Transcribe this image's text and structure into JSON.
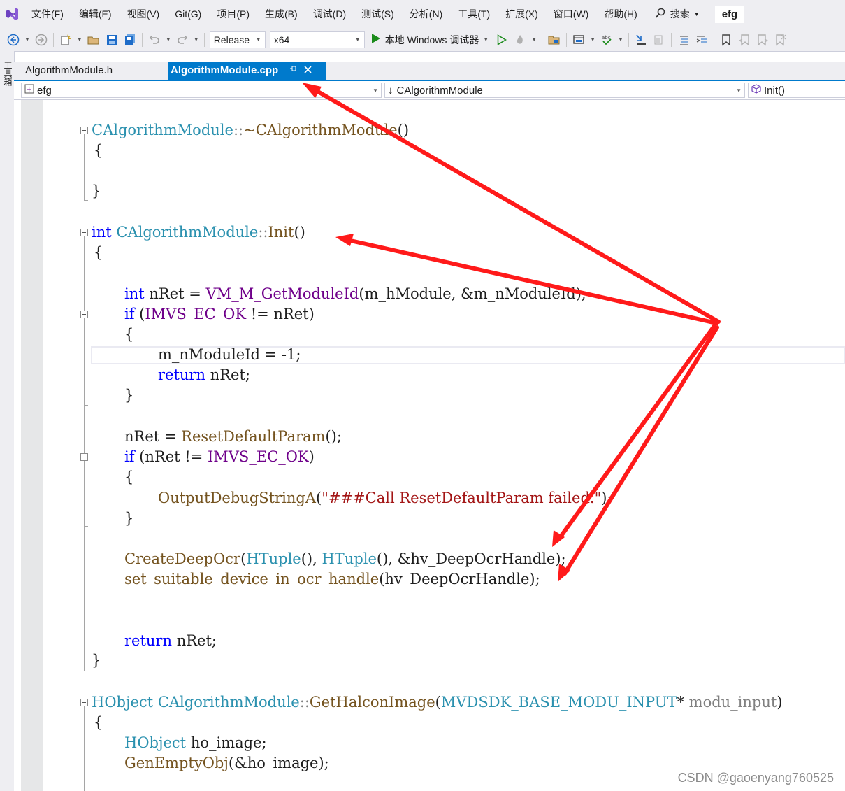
{
  "menu": {
    "items": [
      "文件(F)",
      "编辑(E)",
      "视图(V)",
      "Git(G)",
      "项目(P)",
      "生成(B)",
      "调试(D)",
      "测试(S)",
      "分析(N)",
      "工具(T)",
      "扩展(X)",
      "窗口(W)",
      "帮助(H)"
    ],
    "search_label": "搜索",
    "solution_name": "efg"
  },
  "toolbar": {
    "configuration": "Release",
    "platform": "x64",
    "run_label": "本地 Windows 调试器"
  },
  "toolbox": {
    "label": "工具箱"
  },
  "tabs": [
    {
      "label": "AlgorithmModule.h",
      "active": false
    },
    {
      "label": "AlgorithmModule.cpp",
      "active": true
    }
  ],
  "navbar": {
    "project": "efg",
    "scope": "CAlgorithmModule",
    "member": "Init()"
  },
  "code": {
    "l1_class": "CAlgorithmModule",
    "l1_sep": "::",
    "l1_name": "~CAlgorithmModule",
    "l1_parens": "()",
    "open_brace": "{",
    "close_brace": "}",
    "l2_int": "int",
    "l2_class": "CAlgorithmModule",
    "l2_sep": "::",
    "l2_name": "Init",
    "l2_parens": "()",
    "l3_int": "int",
    "l3_var": "nRet",
    "l3_eq": " = ",
    "l3_macro": "VM_M_GetModuleId",
    "l3_args": "(m_hModule, &m_nModuleId);",
    "l4_if": "if",
    "l4_open": " (",
    "l4_macro": "IMVS_EC_OK",
    "l4_ne": " != ",
    "l4_var": "nRet",
    "l4_close": ")",
    "l5_text": "m_nModuleId = -1;",
    "l6_return": "return",
    "l6_var": "nRet",
    "l6_semi": ";",
    "l7_var": "nRet",
    "l7_eq": " = ",
    "l7_fn": "ResetDefaultParam",
    "l7_rest": "();",
    "l8_if": "if",
    "l8_open": " (",
    "l8_var": "nRet",
    "l8_ne": " != ",
    "l8_macro": "IMVS_EC_OK",
    "l8_close": ")",
    "l9_fn": "OutputDebugStringA",
    "l9_open": "(",
    "l9_str": "\"###Call ResetDefaultParam failed.\"",
    "l9_close": ");",
    "l10_fn": "CreateDeepOcr",
    "l10_open": "(",
    "l10_t1": "HTuple",
    "l10_m": "(), ",
    "l10_t2": "HTuple",
    "l10_rest": "(), &hv_DeepOcrHandle);",
    "l11_fn": "set_suitable_device_in_ocr_handle",
    "l11_rest": "(hv_DeepOcrHandle);",
    "l12_return": "return",
    "l12_var": "nRet",
    "l12_semi": ";",
    "l13_type": "HObject",
    "l13_class": "CAlgorithmModule",
    "l13_sep": "::",
    "l13_fn": "GetHalconImage",
    "l13_open": "(",
    "l13_ptype": "MVDSDK_BASE_MODU_INPUT",
    "l13_star": "* ",
    "l13_param": "modu_input",
    "l13_close": ")",
    "l14_type": "HObject",
    "l14_var": "ho_image",
    "l14_semi": ";",
    "l15_fn": "GenEmptyObj",
    "l15_rest": "(&ho_image);"
  },
  "watermark": "CSDN @gaoenyang760525",
  "colors": {
    "accent": "#007acc",
    "keyword": "#0000ff",
    "type": "#2b91af",
    "function": "#74531f",
    "macro": "#6f008a",
    "string": "#a31515",
    "annotation_arrow": "#ff1a1a"
  }
}
